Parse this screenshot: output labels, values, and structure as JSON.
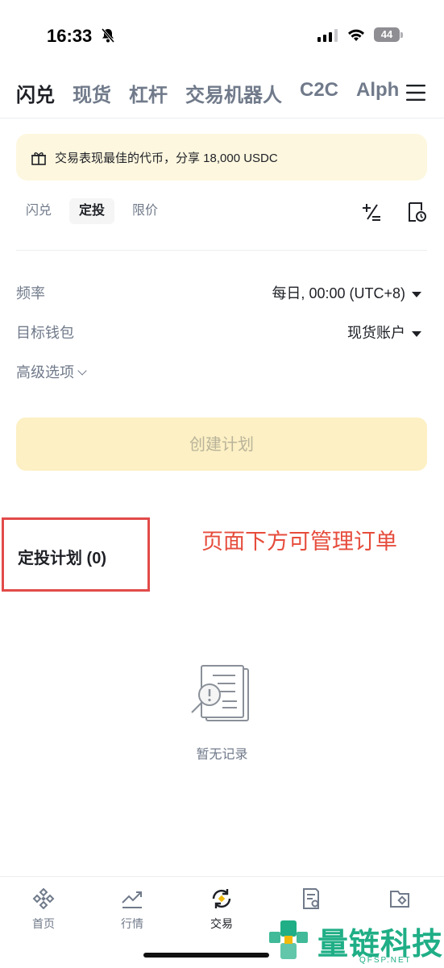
{
  "status_bar": {
    "time": "16:33",
    "battery": "44"
  },
  "main_tabs": [
    "闪兑",
    "现货",
    "杠杆",
    "交易机器人",
    "C2C",
    "Alph"
  ],
  "promo": {
    "text": "交易表现最佳的代币，分享 18,000 USDC"
  },
  "sub_tabs": [
    "闪兑",
    "定投",
    "限价"
  ],
  "form": {
    "frequency_label": "频率",
    "frequency_value": "每日, 00:00 (UTC+8)",
    "wallet_label": "目标钱包",
    "wallet_value": "现货账户",
    "advanced_label": "高级选项"
  },
  "create_button": "创建计划",
  "plans": {
    "title": "定投计划 (0)"
  },
  "annotation": "页面下方可管理订单",
  "empty": {
    "text": "暂无记录"
  },
  "bottom_nav": [
    "首页",
    "行情",
    "交易"
  ],
  "watermark": {
    "text": "量链科技",
    "sub": "QFSP.NET"
  },
  "colors": {
    "accent": "#f0b90b",
    "annotation_red": "#e24a4a",
    "watermark_green": "#1fae86"
  }
}
